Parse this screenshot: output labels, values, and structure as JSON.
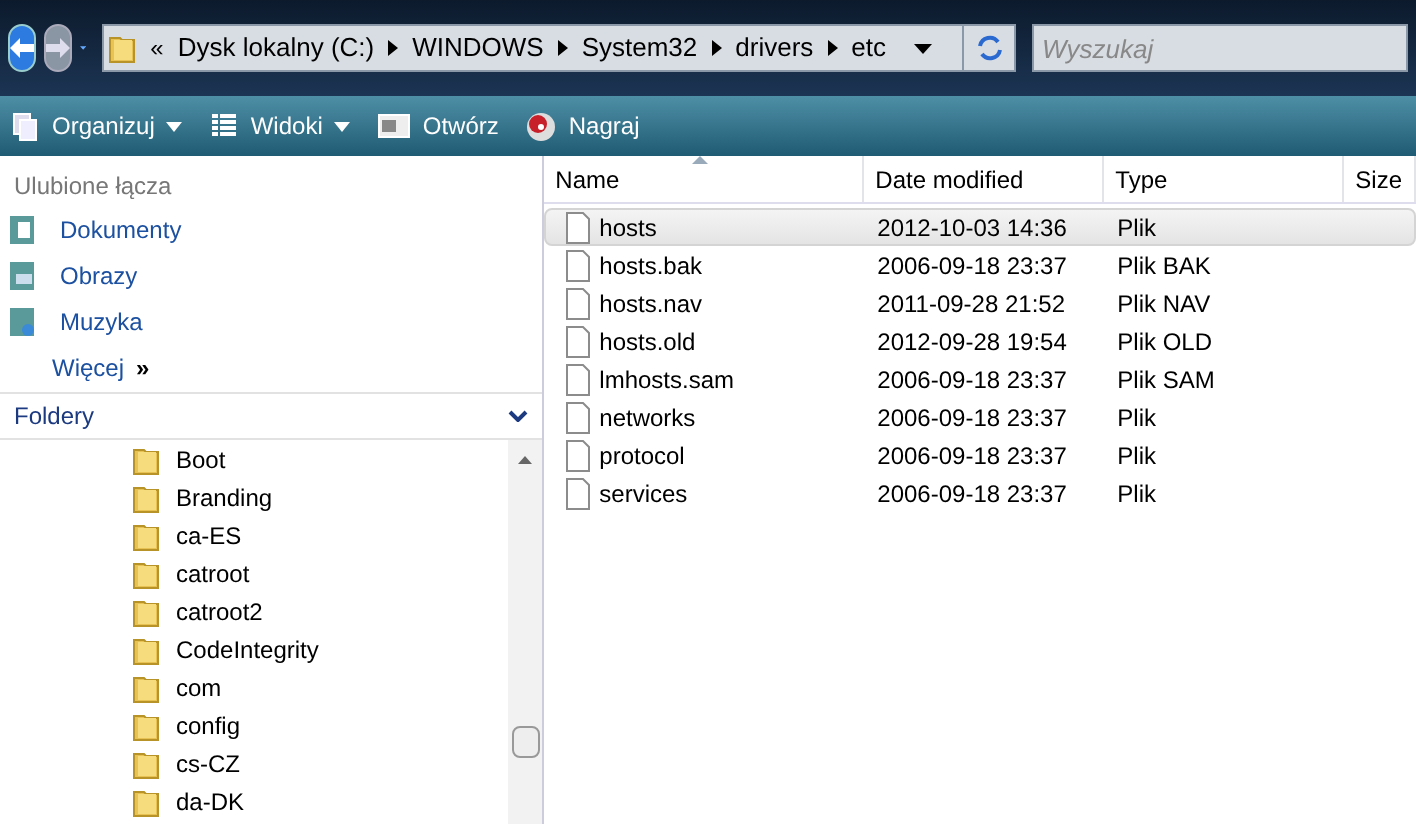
{
  "address_bar": {
    "overflow": "«",
    "crumbs": [
      "Dysk lokalny (C:)",
      "WINDOWS",
      "System32",
      "drivers",
      "etc"
    ]
  },
  "search": {
    "placeholder": "Wyszukaj"
  },
  "toolbar": [
    {
      "label": "Organizuj",
      "kind": "organize",
      "dropdown": true
    },
    {
      "label": "Widoki",
      "kind": "views",
      "dropdown": true
    },
    {
      "label": "Otwórz",
      "kind": "open",
      "dropdown": false
    },
    {
      "label": "Nagraj",
      "kind": "burn",
      "dropdown": false
    }
  ],
  "favorites": {
    "title": "Ulubione łącza",
    "items": [
      {
        "label": "Dokumenty",
        "kind": "documents"
      },
      {
        "label": "Obrazy",
        "kind": "pictures"
      },
      {
        "label": "Muzyka",
        "kind": "music"
      }
    ],
    "more": "Więcej",
    "more_mark": "»"
  },
  "folders": {
    "title": "Foldery",
    "items": [
      "Boot",
      "Branding",
      "ca-ES",
      "catroot",
      "catroot2",
      "CodeIntegrity",
      "com",
      "config",
      "cs-CZ",
      "da-DK"
    ]
  },
  "table": {
    "columns": [
      "Name",
      "Date modified",
      "Type",
      "Size"
    ],
    "rows": [
      {
        "name": "hosts",
        "date": "2012-10-03 14:36",
        "type": "Plik",
        "selected": true
      },
      {
        "name": "hosts.bak",
        "date": "2006-09-18 23:37",
        "type": "Plik BAK",
        "selected": false
      },
      {
        "name": "hosts.nav",
        "date": "2011-09-28 21:52",
        "type": "Plik NAV",
        "selected": false
      },
      {
        "name": "hosts.old",
        "date": "2012-09-28 19:54",
        "type": "Plik OLD",
        "selected": false
      },
      {
        "name": "lmhosts.sam",
        "date": "2006-09-18 23:37",
        "type": "Plik SAM",
        "selected": false
      },
      {
        "name": "networks",
        "date": "2006-09-18 23:37",
        "type": "Plik",
        "selected": false
      },
      {
        "name": "protocol",
        "date": "2006-09-18 23:37",
        "type": "Plik",
        "selected": false
      },
      {
        "name": "services",
        "date": "2006-09-18 23:37",
        "type": "Plik",
        "selected": false
      }
    ]
  }
}
